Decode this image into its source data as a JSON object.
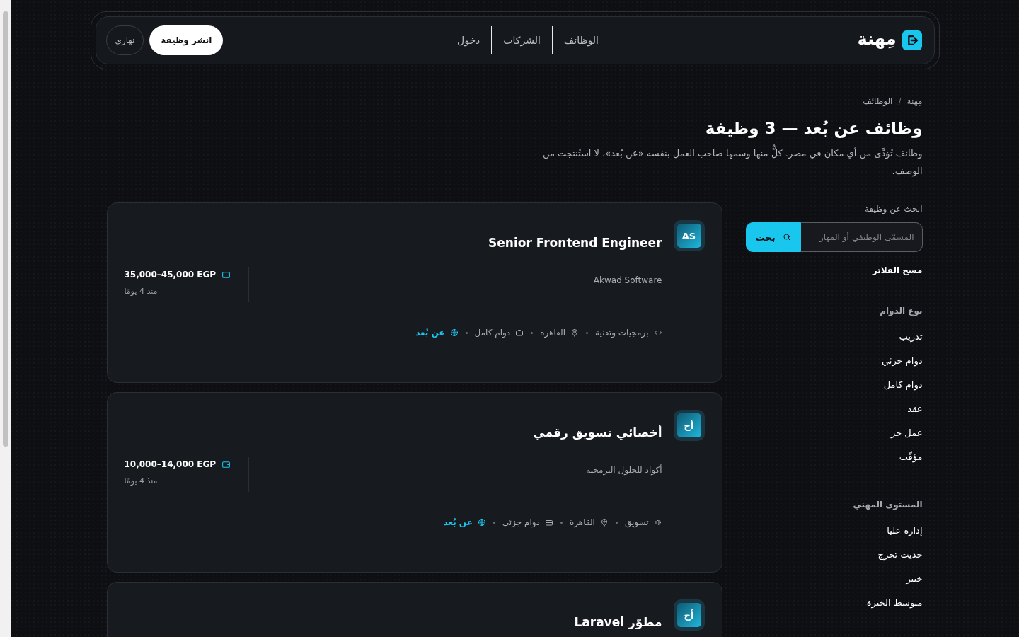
{
  "header": {
    "brand": "مِهنة",
    "nav": [
      {
        "label": "الوظائف"
      },
      {
        "label": "الشركات"
      },
      {
        "label": "دخول"
      }
    ],
    "post_job_button": "انشر وظيفة",
    "theme_toggle": "نهاري"
  },
  "breadcrumb": {
    "items": [
      "مِهنة",
      "الوظائف"
    ],
    "separator": "/"
  },
  "title": "وظائف عن بُعد — 3 وظيفة",
  "description": "وظائف تُؤدَّى من أي مكان في مصر. كلٌّ منها وسمها صاحب العمل بنفسه «عن بُعد»، لا استُنتجت من الوصف.",
  "sidebar": {
    "search": {
      "label": "ابحث عن وظيفة",
      "placeholder": "المسمّى الوظيفي أو المهار",
      "button": "بحث"
    },
    "clear_filters": "مسح الفلاتر",
    "filter_groups": [
      {
        "title": "نوع الدوام",
        "options": [
          "تدريب",
          "دوام جزئي",
          "دوام كامل",
          "عقد",
          "عمل حر",
          "مؤقّت"
        ]
      },
      {
        "title": "المستوى المهني",
        "options": [
          "إدارة عليا",
          "حديث تخرج",
          "خبير",
          "متوسط الخبرة"
        ]
      }
    ]
  },
  "jobs": [
    {
      "logo": "AS",
      "title": "Senior Frontend Engineer",
      "company": "Akwad Software",
      "salary": "35,000–45,000 EGP",
      "posted": "منذ 4 يومًا",
      "tags": [
        {
          "kind": "tech",
          "label": "برمجيات وتقنية"
        },
        {
          "kind": "location",
          "label": "القاهرة"
        },
        {
          "kind": "schedule",
          "label": "دوام كامل"
        },
        {
          "kind": "remote",
          "label": "عن بُعد"
        }
      ]
    },
    {
      "logo": "أح",
      "title": "أخصائي تسويق رقمي",
      "company": "أكواد للحلول البرمجية",
      "salary": "10,000–14,000 EGP",
      "posted": "منذ 4 يومًا",
      "tags": [
        {
          "kind": "marketing",
          "label": "تسويق"
        },
        {
          "kind": "location",
          "label": "القاهرة"
        },
        {
          "kind": "schedule",
          "label": "دوام جزئي"
        },
        {
          "kind": "remote",
          "label": "عن بُعد"
        }
      ]
    },
    {
      "logo": "أح",
      "title": "مطوّر Laravel"
    }
  ]
}
